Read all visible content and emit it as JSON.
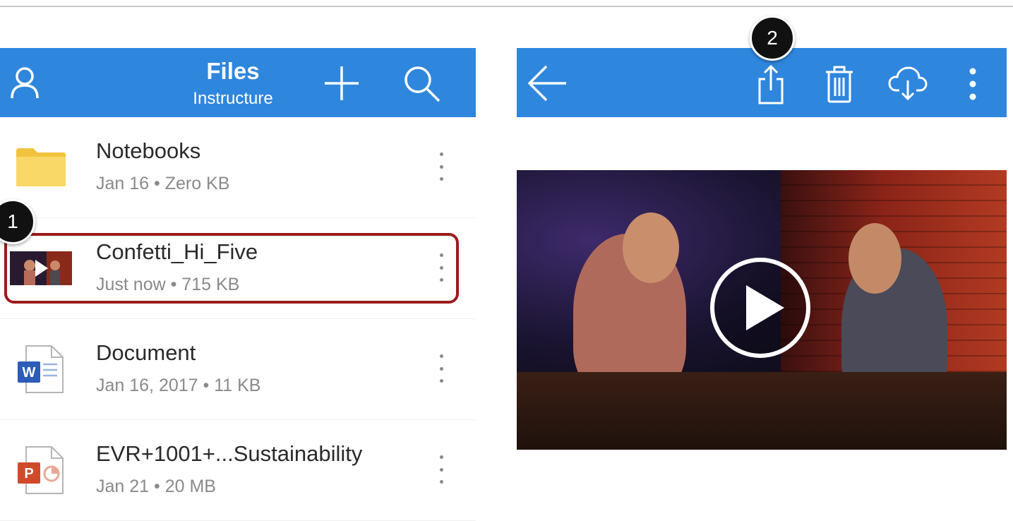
{
  "left_header": {
    "title": "Files",
    "subtitle": "Instructure",
    "icons": [
      "profile-icon",
      "add-icon",
      "search-icon"
    ]
  },
  "files": [
    {
      "name": "Notebooks",
      "meta": "Jan 16 • Zero KB",
      "icon": "folder-icon"
    },
    {
      "name": "Confetti_Hi_Five",
      "meta": "Just now • 715 KB",
      "icon": "video-thumbnail"
    },
    {
      "name": "Document",
      "meta": "Jan 16, 2017 • 11 KB",
      "icon": "word-doc-icon"
    },
    {
      "name": "EVR+1001+...Sustainability",
      "meta": "Jan 21 • 20 MB",
      "icon": "powerpoint-icon"
    }
  ],
  "right_header": {
    "icons": [
      "back-arrow-icon",
      "share-icon",
      "trash-icon",
      "cloud-download-icon",
      "more-vertical-icon"
    ]
  },
  "callouts": {
    "one": "1",
    "two": "2"
  },
  "colors": {
    "header_blue": "#2f86dd",
    "highlight_red": "#9b1c1c",
    "folder_yellow": "#f9d04c",
    "word_blue": "#2b5cb8",
    "ppt_orange": "#d04a2a"
  }
}
